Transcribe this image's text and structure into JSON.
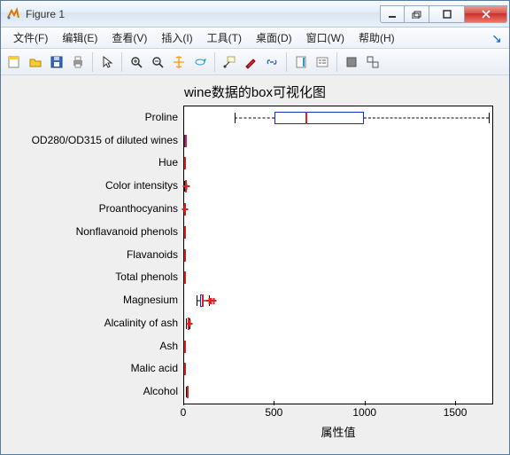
{
  "window": {
    "title": "Figure 1"
  },
  "menus": {
    "file": "文件(F)",
    "edit": "编辑(E)",
    "view": "查看(V)",
    "insert": "插入(I)",
    "tools": "工具(T)",
    "desktop": "桌面(D)",
    "window": "窗口(W)",
    "help": "帮助(H)"
  },
  "toolbar_icons": [
    "new-figure",
    "open",
    "save",
    "print",
    "|",
    "pointer",
    "|",
    "zoom-in",
    "zoom-out",
    "pan",
    "rotate3d",
    "|",
    "data-cursor",
    "brush",
    "link",
    "|",
    "colorbar",
    "legend",
    "|",
    "new-subplot",
    "hide-tools",
    "dock"
  ],
  "chart_data": {
    "type": "boxplot",
    "title": "wine数据的box可视化图",
    "xlabel": "属性值",
    "ylabel": "",
    "orientation": "horizontal",
    "xlim": [
      0,
      1700
    ],
    "xticks": [
      0,
      500,
      1000,
      1500
    ],
    "categories": [
      "Proline",
      "OD280/OD315 of diluted wines",
      "Hue",
      "Color intensitys",
      "Proanthocyanins",
      "Nonflavanoid phenols",
      "Flavanoids",
      "Total phenols",
      "Magnesium",
      "Alcalinity of ash",
      "Ash",
      "Malic acid",
      "Alcohol"
    ],
    "boxes": [
      {
        "min": 278,
        "q1": 500,
        "median": 670,
        "q3": 990,
        "max": 1680,
        "outliers": []
      },
      {
        "min": 1.3,
        "q1": 1.9,
        "median": 2.8,
        "q3": 3.2,
        "max": 4.0,
        "outliers": []
      },
      {
        "min": 0.48,
        "q1": 0.78,
        "median": 0.96,
        "q3": 1.12,
        "max": 1.71,
        "outliers": []
      },
      {
        "min": 1.3,
        "q1": 3.2,
        "median": 4.7,
        "q3": 6.2,
        "max": 10.8,
        "outliers": [
          11.5,
          12.0,
          13.0
        ]
      },
      {
        "min": 0.41,
        "q1": 1.25,
        "median": 1.55,
        "q3": 1.95,
        "max": 2.96,
        "outliers": [
          3.28,
          3.58
        ]
      },
      {
        "min": 0.13,
        "q1": 0.27,
        "median": 0.34,
        "q3": 0.44,
        "max": 0.66,
        "outliers": []
      },
      {
        "min": 0.34,
        "q1": 1.2,
        "median": 2.1,
        "q3": 2.9,
        "max": 5.1,
        "outliers": []
      },
      {
        "min": 0.98,
        "q1": 1.74,
        "median": 2.35,
        "q3": 2.8,
        "max": 3.88,
        "outliers": []
      },
      {
        "min": 70,
        "q1": 88,
        "median": 98,
        "q3": 107,
        "max": 135,
        "outliers": [
          139,
          151,
          162
        ]
      },
      {
        "min": 10.6,
        "q1": 17.2,
        "median": 19.5,
        "q3": 21.5,
        "max": 27.0,
        "outliers": [
          30.0
        ]
      },
      {
        "min": 1.36,
        "q1": 2.21,
        "median": 2.36,
        "q3": 2.56,
        "max": 3.23,
        "outliers": []
      },
      {
        "min": 0.74,
        "q1": 1.6,
        "median": 1.87,
        "q3": 3.1,
        "max": 5.8,
        "outliers": []
      },
      {
        "min": 11.0,
        "q1": 12.4,
        "median": 13.1,
        "q3": 13.7,
        "max": 14.8,
        "outliers": []
      }
    ]
  }
}
